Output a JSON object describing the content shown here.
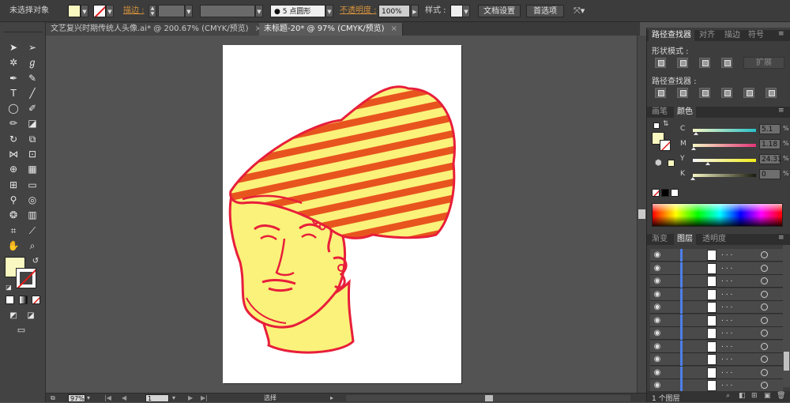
{
  "control_bar": {
    "selection_label": "未选择对象",
    "stroke_label": "描边 :",
    "brush_label": "5 点圆形",
    "opacity_label": "不透明度 :",
    "opacity_value": "100%",
    "style_label": "样式 :",
    "doc_setup_button": "文档设置",
    "preferences_button": "首选项",
    "fill_color": "#f9f8c0"
  },
  "tabs": [
    {
      "label": "文艺复兴时期传统人头像.ai* @ 200.67% (CMYK/预览)",
      "active": false
    },
    {
      "label": "未标题-20* @ 97% (CMYK/预览)",
      "active": true
    }
  ],
  "status_bar": {
    "zoom": "97%",
    "page": "1",
    "tool": "选择"
  },
  "pathfinder_panel": {
    "tabs": [
      "路径查找器",
      "对齐",
      "描边",
      "符号"
    ],
    "shape_modes_label": "形状模式 :",
    "pathfinders_label": "路径查找器 :",
    "expand_button": "扩展"
  },
  "color_panel": {
    "tabs": [
      "画笔",
      "颜色"
    ],
    "channels": [
      {
        "name": "C",
        "value": "5.1",
        "fraction": 0.051
      },
      {
        "name": "M",
        "value": "1.18",
        "fraction": 0.0118
      },
      {
        "name": "Y",
        "value": "24.31",
        "fraction": 0.2431
      },
      {
        "name": "K",
        "value": "0",
        "fraction": 0.0
      }
    ],
    "pct": "%"
  },
  "layers_panel": {
    "tabs": [
      "渐变",
      "图层",
      "透明度"
    ],
    "rows": [
      ". . .",
      ". . .",
      ". . .",
      ". . .",
      ". . .",
      ". . .",
      ". . .",
      ". . .",
      ". . .",
      ". . .",
      ". . ."
    ],
    "footer_count": "1 个图层"
  },
  "colors": {
    "art_fill": "#faf27a",
    "art_stroke": "#e81e3a",
    "stripe_orange": "#e8541e"
  }
}
